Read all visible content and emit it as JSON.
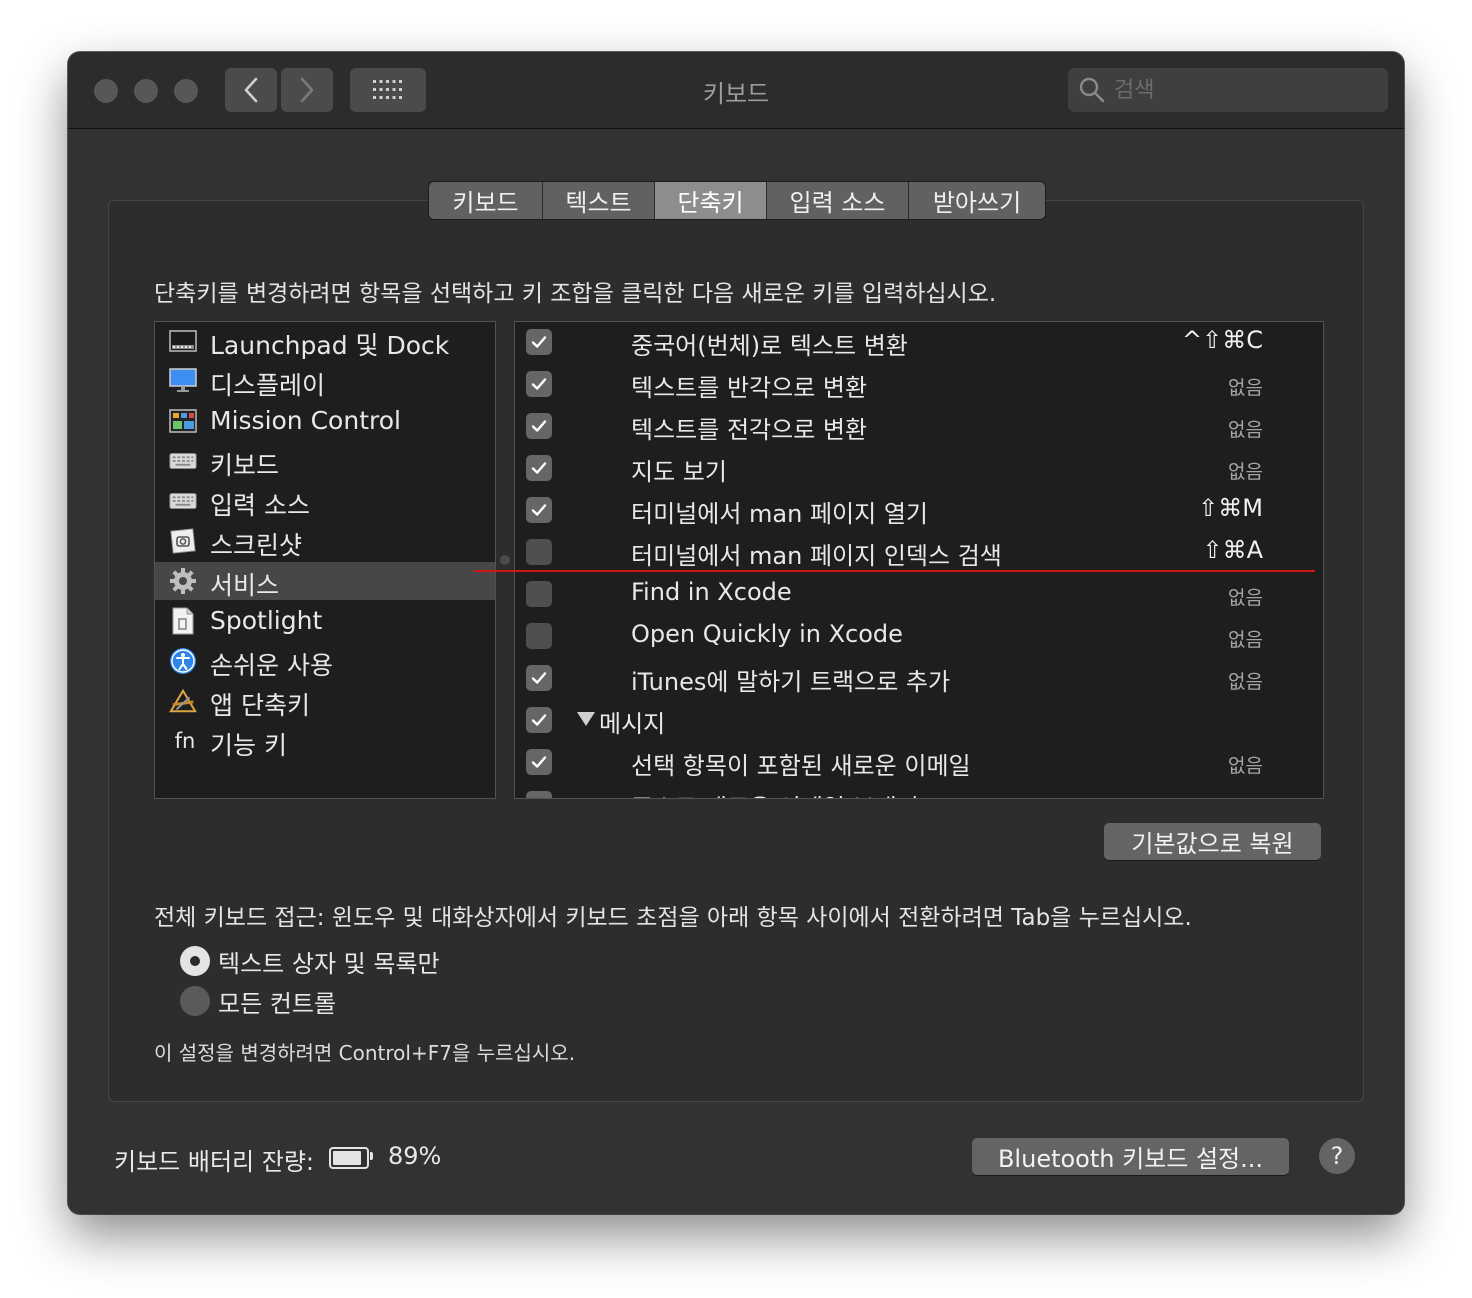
{
  "window": {
    "title": "키보드"
  },
  "search": {
    "placeholder": "검색"
  },
  "tabs": [
    {
      "label": "키보드",
      "selected": false
    },
    {
      "label": "텍스트",
      "selected": false
    },
    {
      "label": "단축키",
      "selected": true
    },
    {
      "label": "입력 소스",
      "selected": false
    },
    {
      "label": "받아쓰기",
      "selected": false
    }
  ],
  "instructions": "단축키를 변경하려면 항목을 선택하고 키 조합을 클릭한 다음 새로운 키를 입력하십시오.",
  "categories": [
    {
      "label": "Launchpad 및 Dock",
      "icon": "launchpad-dock-icon"
    },
    {
      "label": "디스플레이",
      "icon": "display-icon"
    },
    {
      "label": "Mission Control",
      "icon": "mission-control-icon"
    },
    {
      "label": "키보드",
      "icon": "keyboard-icon"
    },
    {
      "label": "입력 소스",
      "icon": "input-source-icon"
    },
    {
      "label": "스크린샷",
      "icon": "screenshot-icon"
    },
    {
      "label": "서비스",
      "icon": "gear-icon",
      "selected": true
    },
    {
      "label": "Spotlight",
      "icon": "spotlight-icon"
    },
    {
      "label": "손쉬운 사용",
      "icon": "accessibility-icon"
    },
    {
      "label": "앱 단축키",
      "icon": "app-shortcuts-icon"
    },
    {
      "label": "기능 키",
      "icon": "fn-key-icon",
      "icon_text": "fn"
    }
  ],
  "shortcuts": [
    {
      "checked": true,
      "label": "중국어(번체)로 텍스트 변환",
      "key": "^⇧⌘C"
    },
    {
      "checked": true,
      "label": "텍스트를 반각으로 변환",
      "key": "없음"
    },
    {
      "checked": true,
      "label": "텍스트를 전각으로 변환",
      "key": "없음"
    },
    {
      "checked": true,
      "label": "지도 보기",
      "key": "없음"
    },
    {
      "checked": true,
      "label": "터미널에서 man 페이지 열기",
      "key": "⇧⌘M"
    },
    {
      "checked": false,
      "label": "터미널에서 man 페이지 인덱스 검색",
      "key": "⇧⌘A"
    },
    {
      "checked": false,
      "label": "Find in Xcode",
      "key": "없음"
    },
    {
      "checked": false,
      "label": "Open Quickly in Xcode",
      "key": "없음"
    },
    {
      "checked": true,
      "label": "iTunes에 말하기 트랙으로 추가",
      "key": "없음"
    },
    {
      "checked": true,
      "label": "메시지",
      "group": true
    },
    {
      "checked": true,
      "label": "선택 항목이 포함된 새로운 이메일",
      "key": "없음"
    },
    {
      "checked": true,
      "label": "주소로 새로운 이메일 보내기",
      "key": "없음"
    }
  ],
  "restore_button": "기본값으로 복원",
  "full_keyboard_access": {
    "text": "전체 키보드 접근: 윈도우 및 대화상자에서 키보드 초점을 아래 항목 사이에서 전환하려면 Tab을 누르십시오.",
    "options": [
      {
        "label": "텍스트 상자 및 목록만",
        "selected": true
      },
      {
        "label": "모든 컨트롤",
        "selected": false
      }
    ],
    "note": "이 설정을 변경하려면 Control+F7을 누르십시오."
  },
  "battery": {
    "label": "키보드 배터리 잔량:",
    "level": "89%",
    "fraction": 0.89
  },
  "bluetooth_button": "Bluetooth 키보드 설정...",
  "help_button": "?"
}
